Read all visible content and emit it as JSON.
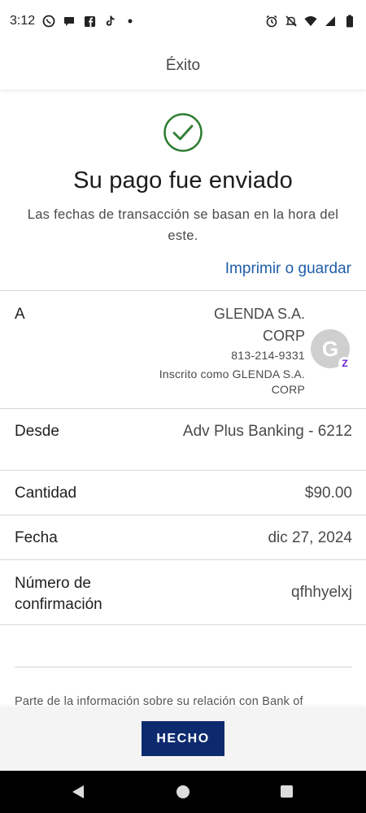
{
  "status_bar": {
    "time": "3:12",
    "left_icons": [
      "whatsapp-icon",
      "chat-bubble-icon",
      "facebook-icon",
      "tiktok-icon",
      "dot-icon"
    ],
    "right_icons": [
      "alarm-icon",
      "mute-icon",
      "wifi-icon",
      "signal-icon",
      "battery-icon"
    ]
  },
  "header": {
    "title": "Éxito"
  },
  "success": {
    "title": "Su pago fue enviado",
    "subtitle": "Las fechas de transacción se basan en la hora del este."
  },
  "actions": {
    "print_save": "Imprimir o guardar"
  },
  "recipient": {
    "label": "A",
    "name": "GLENDA S.A. CORP",
    "phone": "813-214-9331",
    "enrolled_as": "Inscrito como GLENDA S.A. CORP",
    "avatar_initial": "G",
    "badge": "Z"
  },
  "details": {
    "from_label": "Desde",
    "from_value": "Adv Plus Banking - 6212",
    "amount_label": "Cantidad",
    "amount_value": "$90.00",
    "date_label": "Fecha",
    "date_value": "dic 27, 2024",
    "confirmation_label": "Número de confirmación",
    "confirmation_value": "qfhhyelxj"
  },
  "disclaimer": "Parte de la información sobre su relación con Bank of",
  "footer": {
    "done_button": "HECHO"
  },
  "colors": {
    "accent": "#1f5ea8",
    "success_green": "#2e7d32",
    "button_navy": "#0e2a6f",
    "zelle_purple": "#6d1ed4"
  }
}
